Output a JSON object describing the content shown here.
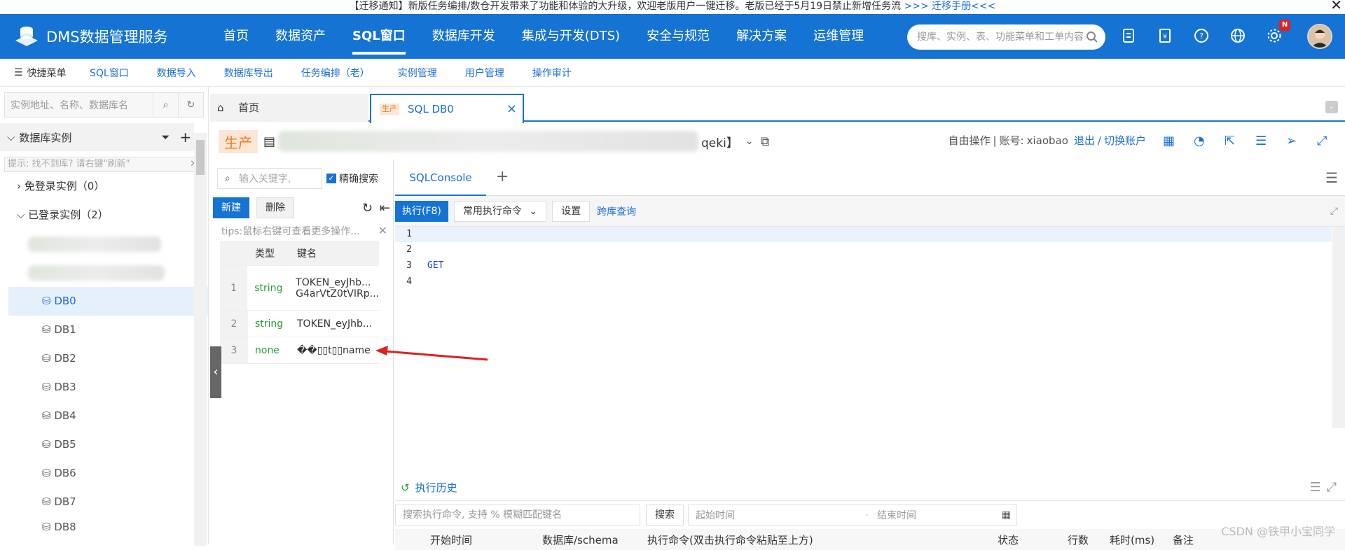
{
  "notice": {
    "text": "【迁移通知】新版任务编排/数仓开发带来了功能和体验的大升级，欢迎老版用户一键迁移。老版已经于5月19日禁止新增任务流",
    "link": ">>> 迁移手册<<<"
  },
  "header": {
    "product": "DMS数据管理服务",
    "nav": [
      "首页",
      "数据资产",
      "SQL窗口",
      "数据库开发",
      "集成与开发(DTS)",
      "安全与规范",
      "解决方案",
      "运维管理"
    ],
    "active_nav": "SQL窗口",
    "search_placeholder": "搜库、实例、表、功能菜单和工单内容",
    "badge": "N",
    "brand_color": "#1573d4"
  },
  "quickbar": {
    "menu_label": "快捷菜单",
    "links": [
      "SQL窗口",
      "数据导入",
      "数据库导出",
      "任务编排（老）",
      "实例管理",
      "用户管理",
      "操作审计"
    ]
  },
  "sidebar": {
    "search_placeholder": "实例地址、名称、数据库名",
    "title": "数据库实例",
    "hint": "提示: 找不到库? 请右键\"刷新\"",
    "groups": [
      {
        "label": "免登录实例（0）"
      },
      {
        "label": "已登录实例（2）"
      }
    ],
    "databases": [
      "DB0",
      "DB1",
      "DB2",
      "DB3",
      "DB4",
      "DB5",
      "DB6",
      "DB7",
      "DB8"
    ],
    "selected_db": "DB0"
  },
  "tabs": {
    "home": "首页",
    "env_small": "生产",
    "sql": "SQL DB0"
  },
  "connection": {
    "env": "生产",
    "suffix": "qeki】",
    "mode": "自由操作",
    "account_label": "账号:",
    "account": "xiaobao",
    "logout": "退出",
    "switch": "切换账户"
  },
  "keys": {
    "search_placeholder": "输入关键字,",
    "exact_label": "精确搜索",
    "new_btn": "新建",
    "delete_btn": "删除",
    "tips": "tips:鼠标右键可查看更多操作...",
    "col_type": "类型",
    "col_name": "键名",
    "rows": [
      {
        "no": "1",
        "type": "string",
        "line1": "TOKEN_eyJhb...",
        "line2": "G4arVtZ0tVIRp..."
      },
      {
        "no": "2",
        "type": "string",
        "line1": "TOKEN_eyJhb...",
        "line2": ""
      },
      {
        "no": "3",
        "type": "none",
        "line1": "��▯▯t▯▯name",
        "line2": ""
      }
    ]
  },
  "editor": {
    "tab": "SQLConsole",
    "run_btn": "执行(F8)",
    "common_cmd": "常用执行命令",
    "settings": "设置",
    "cross_query": "跨库查询",
    "line_numbers": [
      "1",
      "2",
      "3",
      "4"
    ],
    "code_line3": "GET"
  },
  "history": {
    "title": "执行历史",
    "search_placeholder": "搜索执行命令, 支持 % 模糊匹配键名",
    "search_btn": "搜索",
    "start_time": "起始时间",
    "sep": "-",
    "end_time": "结束时间",
    "columns": [
      "开始时间",
      "数据库/schema",
      "执行命令(双击执行命令粘贴至上方)",
      "状态",
      "行数",
      "耗时(ms)",
      "备注"
    ]
  },
  "watermark": "CSDN @铁甲小宝同学"
}
